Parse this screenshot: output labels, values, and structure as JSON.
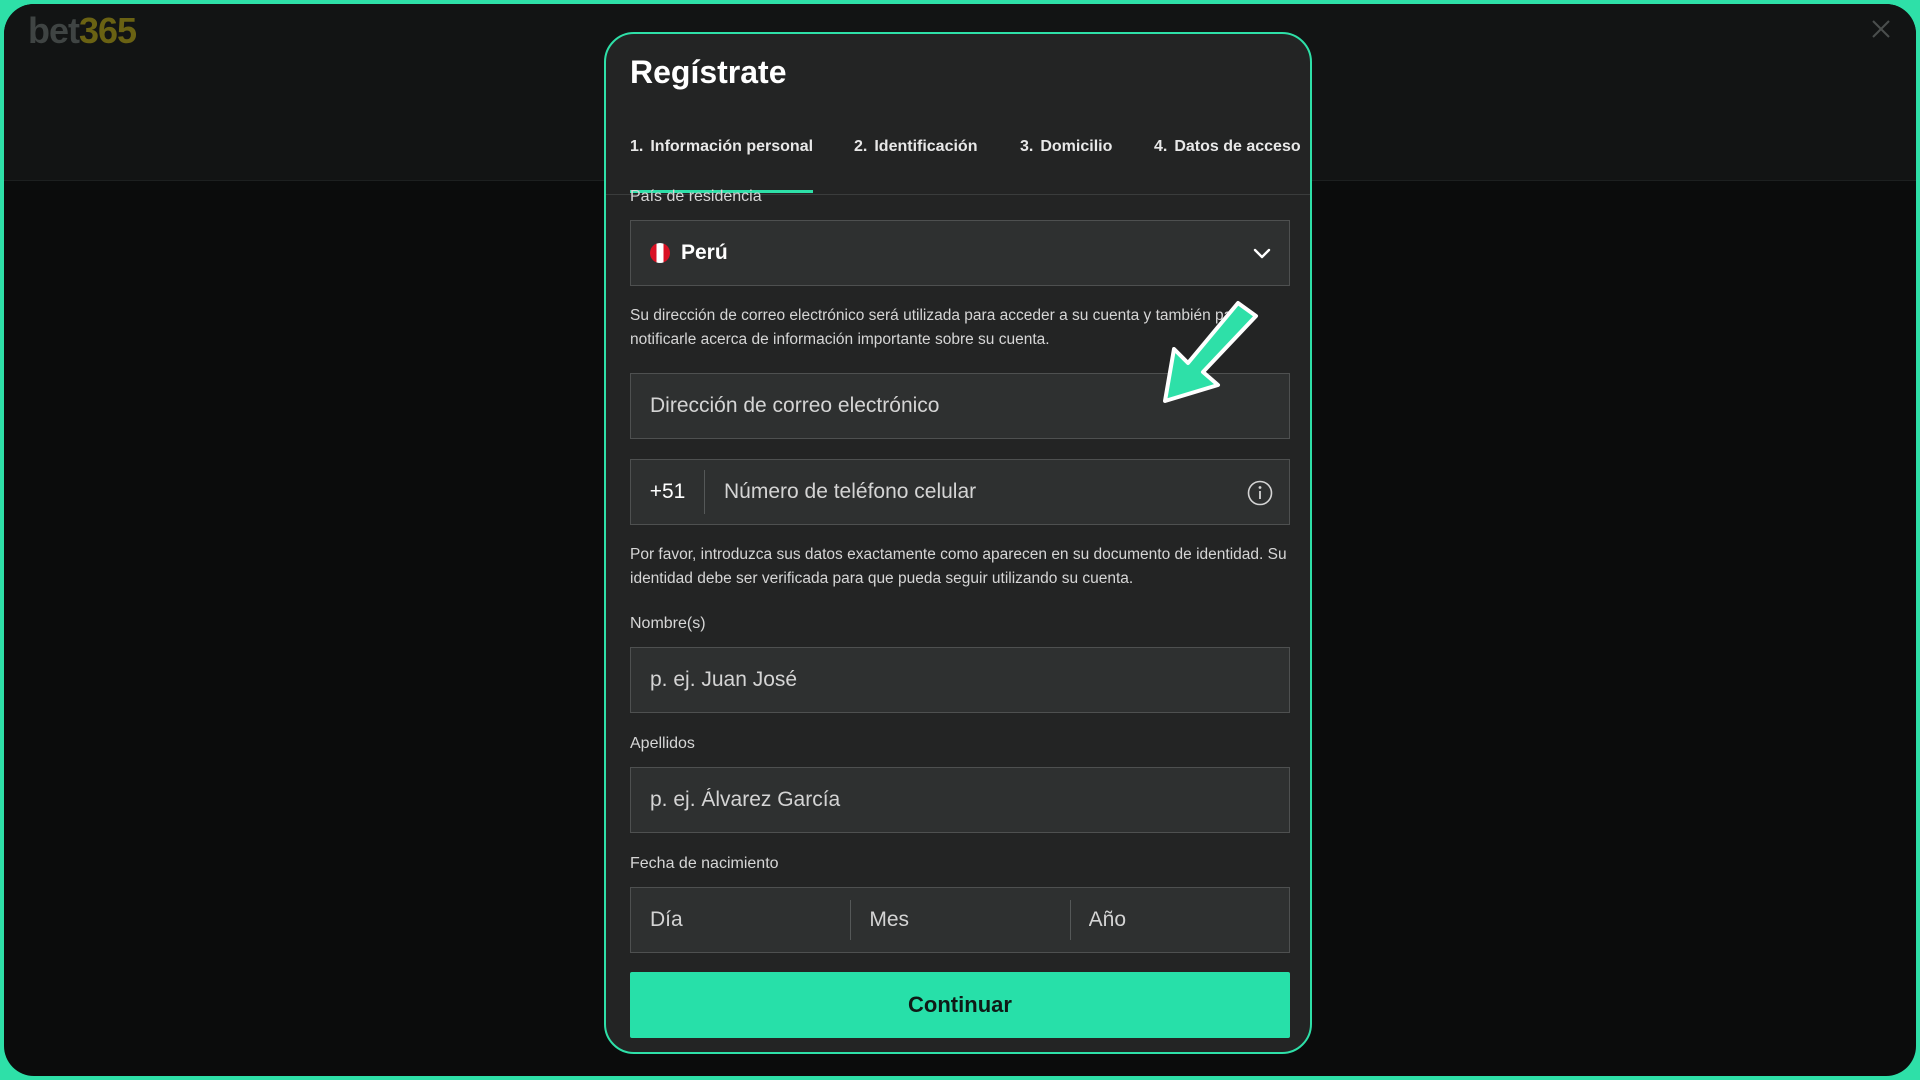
{
  "brand": {
    "logo_bet": "bet",
    "logo_num": "365"
  },
  "modal": {
    "title": "Regístrate",
    "tabs": [
      {
        "num": "1.",
        "label": "Información personal",
        "active": true
      },
      {
        "num": "2.",
        "label": "Identificación",
        "active": false
      },
      {
        "num": "3.",
        "label": "Domicilio",
        "active": false
      },
      {
        "num": "4.",
        "label": "Datos de acceso",
        "active": false
      }
    ]
  },
  "form": {
    "country_label": "País de residencia",
    "country_value": "Perú",
    "email_note": "Su dirección de correo electrónico será utilizada para acceder a su cuenta y también para notificarle acerca de información importante sobre su cuenta.",
    "email_placeholder": "Dirección de correo electrónico",
    "phone_prefix": "+51",
    "phone_placeholder": "Número de teléfono celular",
    "identity_note": "Por favor, introduzca sus datos exactamente como aparecen en su documento de identidad. Su identidad debe ser verificada para que pueda seguir utilizando su cuenta.",
    "first_name_label": "Nombre(s)",
    "first_name_placeholder": "p. ej. Juan José",
    "last_name_label": "Apellidos",
    "last_name_placeholder": "p. ej. Álvarez García",
    "dob_label": "Fecha de nacimiento",
    "dob_day_placeholder": "Día",
    "dob_month_placeholder": "Mes",
    "dob_year_placeholder": "Año",
    "continue_label": "Continuar"
  },
  "colors": {
    "accent": "#2ee0a8",
    "background": "#0b0c0c",
    "modal_bg": "#232424",
    "field_bg": "#2e3030",
    "flag_red": "#d91023"
  },
  "icons": {
    "close": "close-icon",
    "chevron": "chevron-down-icon",
    "info": "info-icon",
    "flag": "peru-flag-icon",
    "arrow": "pointer-arrow-icon"
  }
}
